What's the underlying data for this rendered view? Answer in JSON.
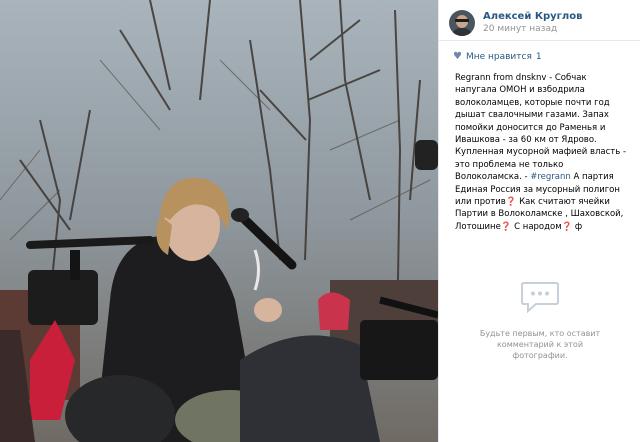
{
  "post": {
    "author": "Алексей Круглов",
    "time": "20 минут назад"
  },
  "likes": {
    "label": "Мне нравится",
    "count": "1",
    "icon": "heart-icon"
  },
  "caption": {
    "part1": "Regrann from dnsknv - Собчак напугала ОМОН и взбодрила волоколамцев, которые почти год дышат свалочными газами. Запах помойки доносится до Раменья и Ивашкова - за 60 км от Ядрово. Купленная мусорной мафией власть - это проблема не только Волоколамска. - ",
    "hashtag": "#regrann",
    "part2": " А партия Единая Россия за мусорный полигон или против❓ Как считают ячейки Партии в Волоколамске , Шаховской, Лотошине❓ С народом❓ ф"
  },
  "comments": {
    "empty_text": "Будьте первым, кто оставит комментарий к этой фотографии.",
    "icon": "comment-bubble-icon"
  }
}
